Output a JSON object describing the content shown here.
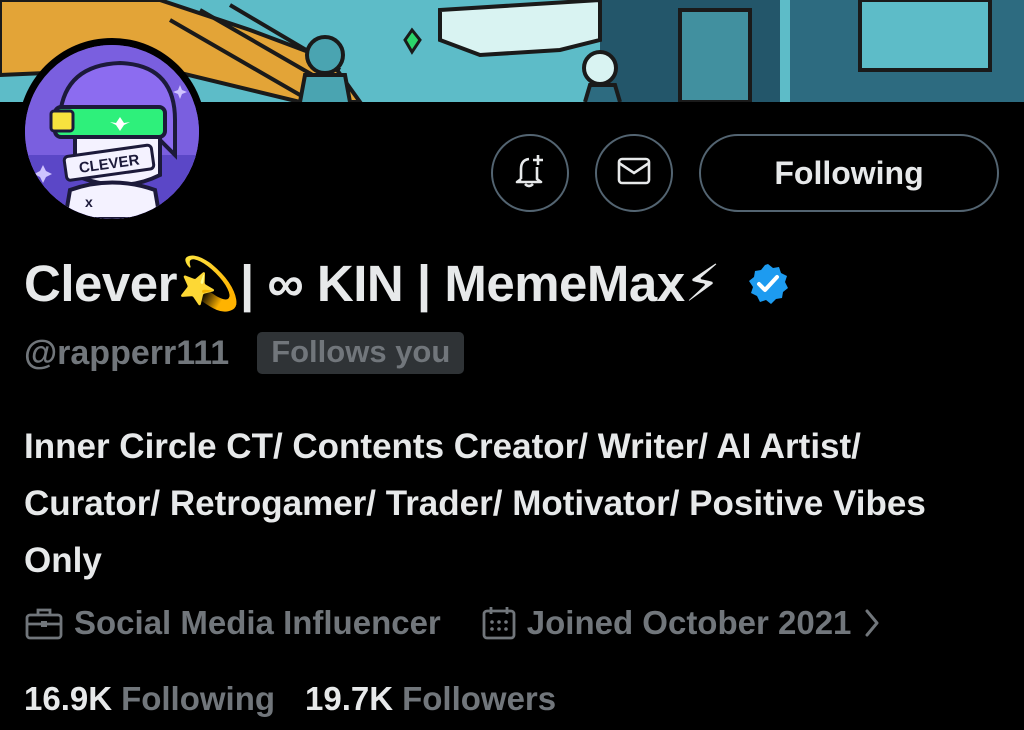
{
  "profile": {
    "display_name": "Clever💫| ∞ KIN | MemeMax⚡",
    "verified_icon": "verified-badge-icon",
    "handle": "@rapperr111",
    "follows_you": "Follows you",
    "bio": "Inner Circle CT/ Contents Creator/ Writer/ AI Artist/ Curator/ Retrogamer/ Trader/ Motivator/ Positive Vibes Only",
    "category": "Social Media Influencer",
    "joined": "Joined October 2021",
    "avatar_text": "CLEVER"
  },
  "actions": {
    "notify_icon": "bell-plus-icon",
    "message_icon": "envelope-icon",
    "following_label": "Following"
  },
  "stats": {
    "following_count": "16.9K",
    "following_label": "Following",
    "followers_count": "19.7K",
    "followers_label": "Followers"
  },
  "colors": {
    "background": "#000000",
    "primary_text": "#e7e9ea",
    "secondary_text": "#71767b",
    "verified_blue": "#1d9bf0",
    "border": "#536471"
  }
}
